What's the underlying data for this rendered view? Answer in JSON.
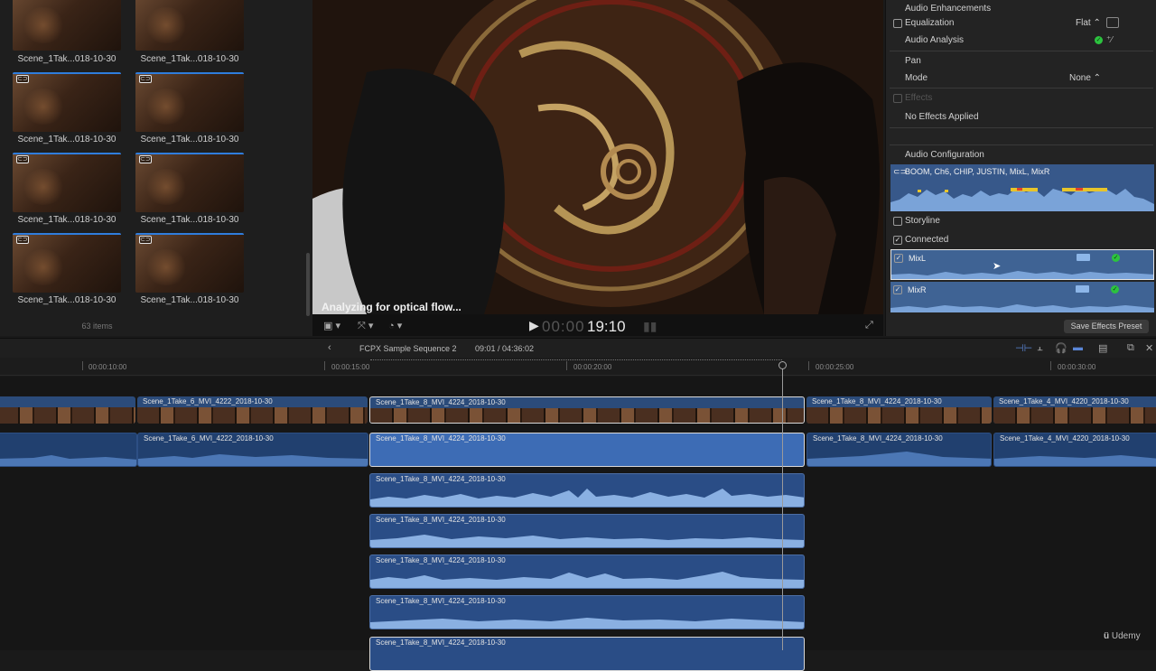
{
  "browser": {
    "thumbnails": [
      {
        "label": "Scene_1Tak...018-10-30"
      },
      {
        "label": "Scene_1Tak...018-10-30"
      },
      {
        "label": "Scene_1Tak...018-10-30"
      },
      {
        "label": "Scene_1Tak...018-10-30"
      },
      {
        "label": "Scene_1Tak...018-10-30"
      },
      {
        "label": "Scene_1Tak...018-10-30"
      },
      {
        "label": "Scene_1Tak...018-10-30"
      },
      {
        "label": "Scene_1Tak...018-10-30"
      }
    ],
    "items_count": "63 items"
  },
  "viewer": {
    "status": "Analyzing for optical flow...",
    "timecode_dim": "00:00",
    "timecode": "19:10"
  },
  "inspector": {
    "audio_enhancements": "Audio Enhancements",
    "equalization_label": "Equalization",
    "equalization_value": "Flat",
    "audio_analysis_label": "Audio Analysis",
    "pan_header": "Pan",
    "mode_label": "Mode",
    "mode_value": "None",
    "effects_label": "Effects",
    "no_effects": "No Effects Applied",
    "audio_configuration": "Audio Configuration",
    "components_label": "BOOM, Ch6, CHIP, JUSTIN, MixL, MixR",
    "storyline_label": "Storyline",
    "connected_label": "Connected",
    "channel_1": "MixL",
    "channel_2": "MixR",
    "save_preset": "Save Effects Preset"
  },
  "timeline": {
    "sequence_name": "FCPX Sample Sequence 2",
    "sequence_timecode": "09:01 / 04:36:02",
    "ruler": [
      "00:00:10:00",
      "00:00:15:00",
      "00:00:20:00",
      "00:00:25:00",
      "00:00:30:00"
    ],
    "video_clips": [
      {
        "name": "Scene_1Take_6_MVI_4222_2018-10-30"
      },
      {
        "name": "Scene_1Take_8_MVI_4224_2018-10-30"
      },
      {
        "name": "Scene_1Take_8_MVI_4224_2018-10-30"
      },
      {
        "name": "Scene_1Take_4_MVI_4220_2018-10-30"
      }
    ],
    "audio_clips": [
      {
        "name": "Scene_1Take_6_MVI_4222_2018-10-30"
      },
      {
        "name": "Scene_1Take_8_MVI_4224_2018-10-30"
      },
      {
        "name": "Scene_1Take_8_MVI_4224_2018-10-30"
      },
      {
        "name": "Scene_1Take_4_MVI_4220_2018-10-30"
      }
    ],
    "component_clips": [
      {
        "name": "Scene_1Take_8_MVI_4224_2018-10-30"
      },
      {
        "name": "Scene_1Take_8_MVI_4224_2018-10-30"
      },
      {
        "name": "Scene_1Take_8_MVI_4224_2018-10-30"
      },
      {
        "name": "Scene_1Take_8_MVI_4224_2018-10-30"
      },
      {
        "name": "Scene_1Take_8_MVI_4224_2018-10-30"
      }
    ]
  },
  "watermark": "Udemy",
  "colors": {
    "accent_blue": "#2f7ddd",
    "clip_blue": "#2a4d86",
    "check_green": "#2cc33f"
  }
}
